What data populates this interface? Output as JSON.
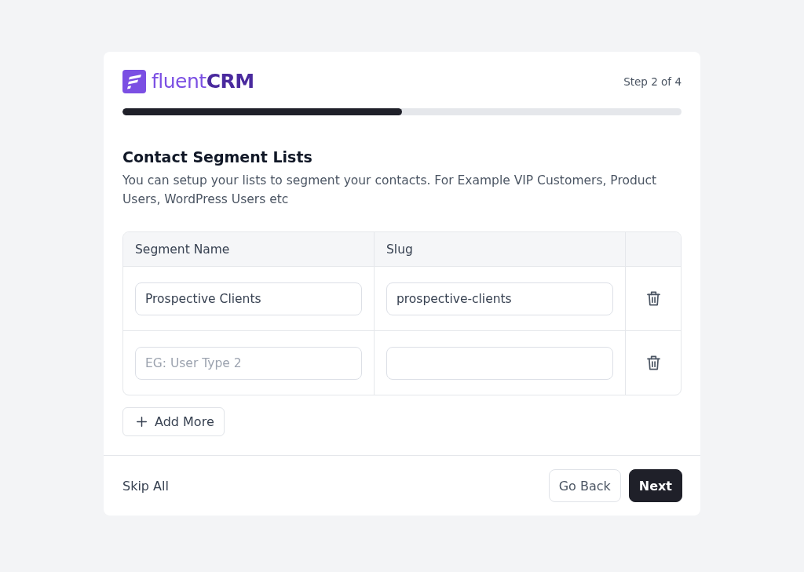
{
  "header": {
    "logo_text": "fluent**CRM**",
    "step": "Step 2 of 4"
  },
  "progress": {
    "level": 0.5
  },
  "section": {
    "title": "Contact Segment Lists",
    "description": "You can setup your lists to segment your contacts. For Example VIP Customers, Product Users, WordPress Users etc"
  },
  "table": {
    "columns": [
      "Segment Name",
      "Slug"
    ],
    "rows": [
      {
        "segment_name": {
          "value": "Prospective Clients"
        },
        "slug": {
          "value": "prospective-clients"
        }
      },
      {
        "segment_name": {
          "placeholder": "EG: User Type 2"
        }
      }
    ]
  },
  "add_button": {
    "label": "Add More"
  },
  "footer": {
    "skip_link": "Skip All",
    "buttons": [
      {
        "label": "Go Back",
        "kind": "secondary"
      },
      {
        "label": "Next",
        "kind": "primary"
      }
    ]
  }
}
